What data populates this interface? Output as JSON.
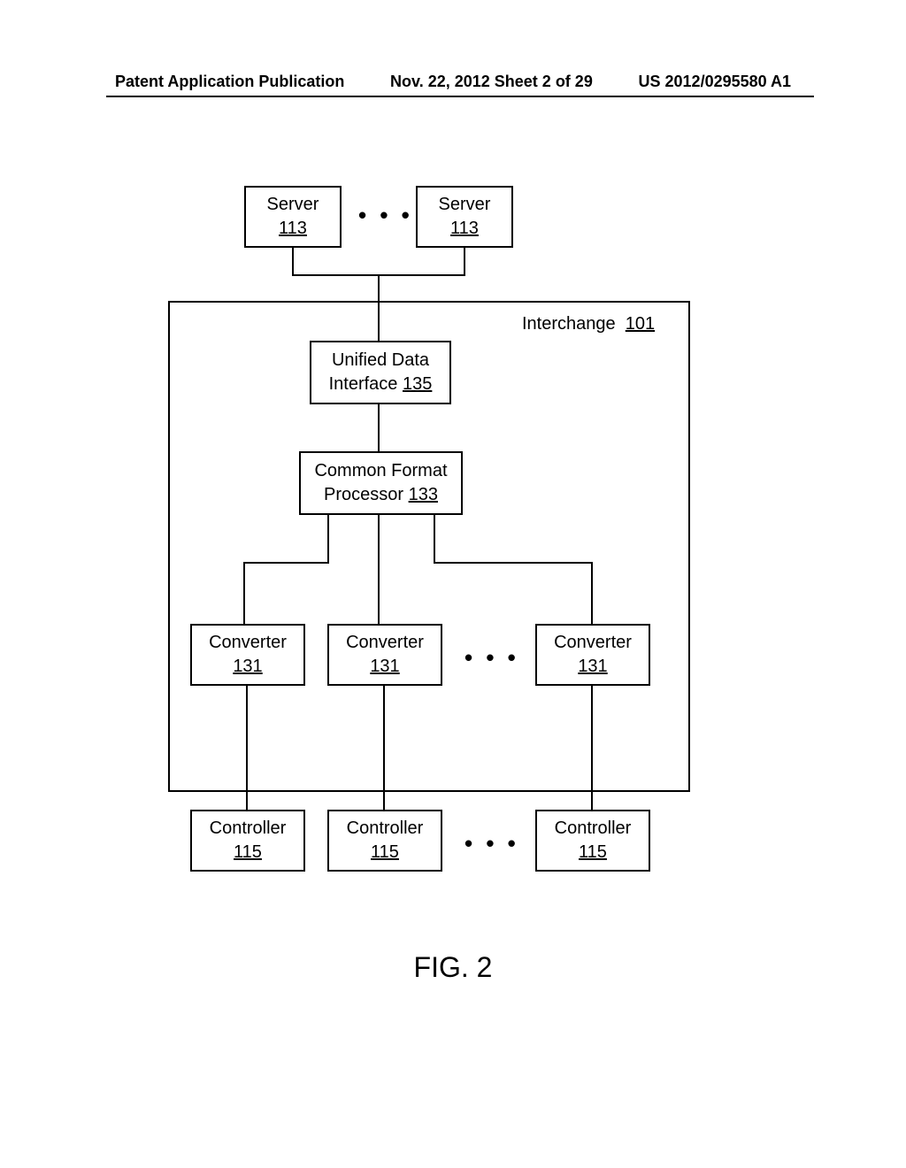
{
  "header": {
    "left": "Patent Application Publication",
    "center": "Nov. 22, 2012  Sheet 2 of 29",
    "right": "US 2012/0295580 A1"
  },
  "servers": {
    "label": "Server",
    "ref": "113",
    "ellipsis": "• • •"
  },
  "interchange": {
    "label": "Interchange",
    "ref": "101"
  },
  "udi": {
    "line1": "Unified Data",
    "line2": "Interface",
    "ref": "135"
  },
  "cfp": {
    "line1": "Common Format",
    "line2": "Processor",
    "ref": "133"
  },
  "converters": {
    "label": "Converter",
    "ref": "131",
    "ellipsis": "• • •"
  },
  "controllers": {
    "label": "Controller",
    "ref": "115",
    "ellipsis": "• • •"
  },
  "figure_label": "FIG. 2"
}
